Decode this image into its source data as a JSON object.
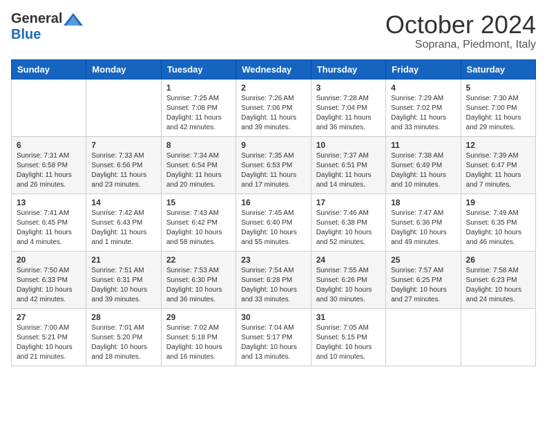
{
  "logo": {
    "general": "General",
    "blue": "Blue"
  },
  "title": "October 2024",
  "location": "Soprana, Piedmont, Italy",
  "days_of_week": [
    "Sunday",
    "Monday",
    "Tuesday",
    "Wednesday",
    "Thursday",
    "Friday",
    "Saturday"
  ],
  "weeks": [
    [
      {
        "day": "",
        "sunrise": "",
        "sunset": "",
        "daylight": ""
      },
      {
        "day": "",
        "sunrise": "",
        "sunset": "",
        "daylight": ""
      },
      {
        "day": "1",
        "sunrise": "Sunrise: 7:25 AM",
        "sunset": "Sunset: 7:08 PM",
        "daylight": "Daylight: 11 hours and 42 minutes."
      },
      {
        "day": "2",
        "sunrise": "Sunrise: 7:26 AM",
        "sunset": "Sunset: 7:06 PM",
        "daylight": "Daylight: 11 hours and 39 minutes."
      },
      {
        "day": "3",
        "sunrise": "Sunrise: 7:28 AM",
        "sunset": "Sunset: 7:04 PM",
        "daylight": "Daylight: 11 hours and 36 minutes."
      },
      {
        "day": "4",
        "sunrise": "Sunrise: 7:29 AM",
        "sunset": "Sunset: 7:02 PM",
        "daylight": "Daylight: 11 hours and 33 minutes."
      },
      {
        "day": "5",
        "sunrise": "Sunrise: 7:30 AM",
        "sunset": "Sunset: 7:00 PM",
        "daylight": "Daylight: 11 hours and 29 minutes."
      }
    ],
    [
      {
        "day": "6",
        "sunrise": "Sunrise: 7:31 AM",
        "sunset": "Sunset: 6:58 PM",
        "daylight": "Daylight: 11 hours and 26 minutes."
      },
      {
        "day": "7",
        "sunrise": "Sunrise: 7:33 AM",
        "sunset": "Sunset: 6:56 PM",
        "daylight": "Daylight: 11 hours and 23 minutes."
      },
      {
        "day": "8",
        "sunrise": "Sunrise: 7:34 AM",
        "sunset": "Sunset: 6:54 PM",
        "daylight": "Daylight: 11 hours and 20 minutes."
      },
      {
        "day": "9",
        "sunrise": "Sunrise: 7:35 AM",
        "sunset": "Sunset: 6:53 PM",
        "daylight": "Daylight: 11 hours and 17 minutes."
      },
      {
        "day": "10",
        "sunrise": "Sunrise: 7:37 AM",
        "sunset": "Sunset: 6:51 PM",
        "daylight": "Daylight: 11 hours and 14 minutes."
      },
      {
        "day": "11",
        "sunrise": "Sunrise: 7:38 AM",
        "sunset": "Sunset: 6:49 PM",
        "daylight": "Daylight: 11 hours and 10 minutes."
      },
      {
        "day": "12",
        "sunrise": "Sunrise: 7:39 AM",
        "sunset": "Sunset: 6:47 PM",
        "daylight": "Daylight: 11 hours and 7 minutes."
      }
    ],
    [
      {
        "day": "13",
        "sunrise": "Sunrise: 7:41 AM",
        "sunset": "Sunset: 6:45 PM",
        "daylight": "Daylight: 11 hours and 4 minutes."
      },
      {
        "day": "14",
        "sunrise": "Sunrise: 7:42 AM",
        "sunset": "Sunset: 6:43 PM",
        "daylight": "Daylight: 11 hours and 1 minute."
      },
      {
        "day": "15",
        "sunrise": "Sunrise: 7:43 AM",
        "sunset": "Sunset: 6:42 PM",
        "daylight": "Daylight: 10 hours and 58 minutes."
      },
      {
        "day": "16",
        "sunrise": "Sunrise: 7:45 AM",
        "sunset": "Sunset: 6:40 PM",
        "daylight": "Daylight: 10 hours and 55 minutes."
      },
      {
        "day": "17",
        "sunrise": "Sunrise: 7:46 AM",
        "sunset": "Sunset: 6:38 PM",
        "daylight": "Daylight: 10 hours and 52 minutes."
      },
      {
        "day": "18",
        "sunrise": "Sunrise: 7:47 AM",
        "sunset": "Sunset: 6:36 PM",
        "daylight": "Daylight: 10 hours and 49 minutes."
      },
      {
        "day": "19",
        "sunrise": "Sunrise: 7:49 AM",
        "sunset": "Sunset: 6:35 PM",
        "daylight": "Daylight: 10 hours and 46 minutes."
      }
    ],
    [
      {
        "day": "20",
        "sunrise": "Sunrise: 7:50 AM",
        "sunset": "Sunset: 6:33 PM",
        "daylight": "Daylight: 10 hours and 42 minutes."
      },
      {
        "day": "21",
        "sunrise": "Sunrise: 7:51 AM",
        "sunset": "Sunset: 6:31 PM",
        "daylight": "Daylight: 10 hours and 39 minutes."
      },
      {
        "day": "22",
        "sunrise": "Sunrise: 7:53 AM",
        "sunset": "Sunset: 6:30 PM",
        "daylight": "Daylight: 10 hours and 36 minutes."
      },
      {
        "day": "23",
        "sunrise": "Sunrise: 7:54 AM",
        "sunset": "Sunset: 6:28 PM",
        "daylight": "Daylight: 10 hours and 33 minutes."
      },
      {
        "day": "24",
        "sunrise": "Sunrise: 7:55 AM",
        "sunset": "Sunset: 6:26 PM",
        "daylight": "Daylight: 10 hours and 30 minutes."
      },
      {
        "day": "25",
        "sunrise": "Sunrise: 7:57 AM",
        "sunset": "Sunset: 6:25 PM",
        "daylight": "Daylight: 10 hours and 27 minutes."
      },
      {
        "day": "26",
        "sunrise": "Sunrise: 7:58 AM",
        "sunset": "Sunset: 6:23 PM",
        "daylight": "Daylight: 10 hours and 24 minutes."
      }
    ],
    [
      {
        "day": "27",
        "sunrise": "Sunrise: 7:00 AM",
        "sunset": "Sunset: 5:21 PM",
        "daylight": "Daylight: 10 hours and 21 minutes."
      },
      {
        "day": "28",
        "sunrise": "Sunrise: 7:01 AM",
        "sunset": "Sunset: 5:20 PM",
        "daylight": "Daylight: 10 hours and 18 minutes."
      },
      {
        "day": "29",
        "sunrise": "Sunrise: 7:02 AM",
        "sunset": "Sunset: 5:18 PM",
        "daylight": "Daylight: 10 hours and 16 minutes."
      },
      {
        "day": "30",
        "sunrise": "Sunrise: 7:04 AM",
        "sunset": "Sunset: 5:17 PM",
        "daylight": "Daylight: 10 hours and 13 minutes."
      },
      {
        "day": "31",
        "sunrise": "Sunrise: 7:05 AM",
        "sunset": "Sunset: 5:15 PM",
        "daylight": "Daylight: 10 hours and 10 minutes."
      },
      {
        "day": "",
        "sunrise": "",
        "sunset": "",
        "daylight": ""
      },
      {
        "day": "",
        "sunrise": "",
        "sunset": "",
        "daylight": ""
      }
    ]
  ]
}
